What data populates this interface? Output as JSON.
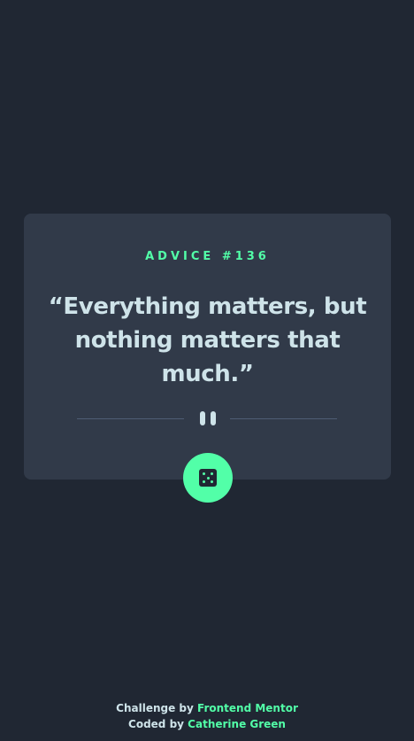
{
  "card": {
    "advice_id": "ADVICE #136",
    "advice_text": "“Everything matters, but nothing matters that much.”"
  },
  "divider": {
    "icon": "pause-icon"
  },
  "dice_button": {
    "icon": "dice-icon"
  },
  "attribution": {
    "challenge_prefix": "Challenge by",
    "challenge_link": "Frontend Mentor",
    "coded_prefix": "Coded by",
    "coded_link": "Catherine Green"
  },
  "colors": {
    "background": "#202733",
    "card": "#313a49",
    "accent": "#52ffa8",
    "text": "#cee3e9",
    "divider": "#4f5d74"
  }
}
